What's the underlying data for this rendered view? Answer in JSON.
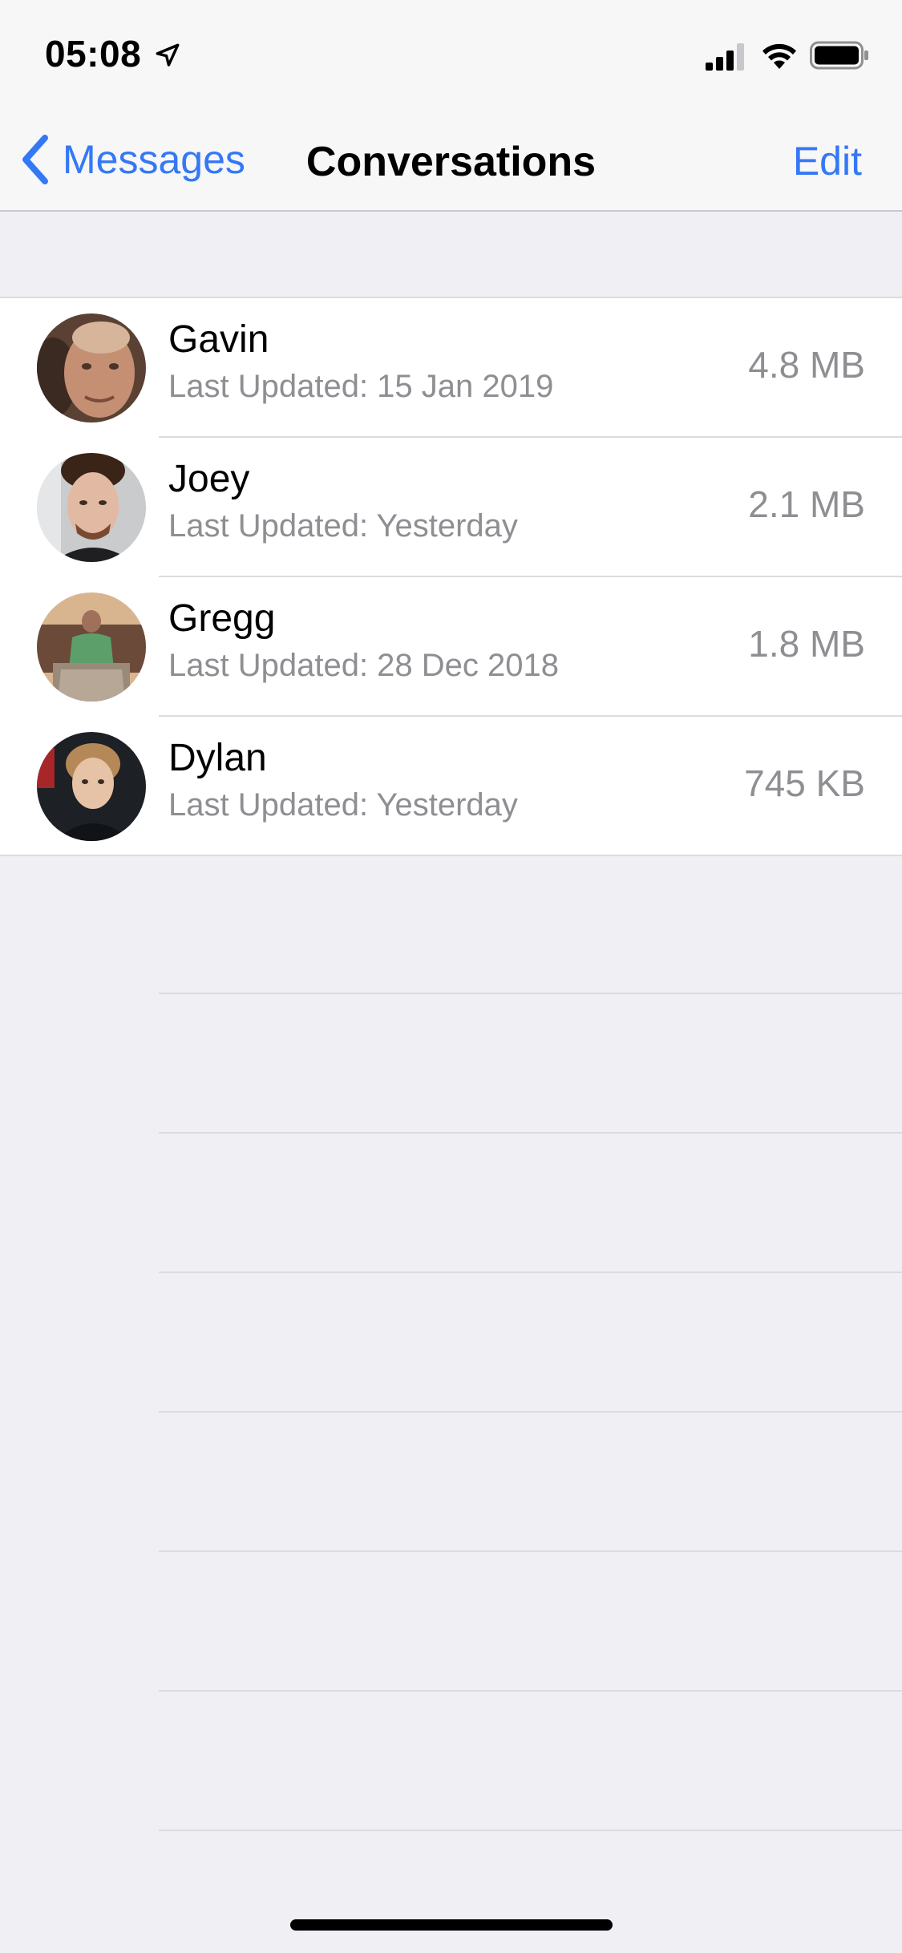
{
  "status_bar": {
    "time": "05:08",
    "icons": [
      "location-arrow-icon",
      "signal-icon",
      "wifi-icon",
      "battery-icon"
    ]
  },
  "nav": {
    "back_label": "Messages",
    "title": "Conversations",
    "edit_label": "Edit"
  },
  "colors": {
    "accent": "#3478f6",
    "secondary_text": "#8e8e93",
    "background": "#efeff4"
  },
  "conversations": [
    {
      "name": "Gavin",
      "subtitle": "Last Updated: 15 Jan 2019",
      "size": "4.8 MB",
      "avatar": "avatar-photo"
    },
    {
      "name": "Joey",
      "subtitle": "Last Updated: Yesterday",
      "size": "2.1 MB",
      "avatar": "avatar-photo"
    },
    {
      "name": "Gregg",
      "subtitle": "Last Updated: 28 Dec 2018",
      "size": "1.8 MB",
      "avatar": "avatar-photo"
    },
    {
      "name": "Dylan",
      "subtitle": "Last Updated: Yesterday",
      "size": "745 KB",
      "avatar": "avatar-photo"
    }
  ]
}
